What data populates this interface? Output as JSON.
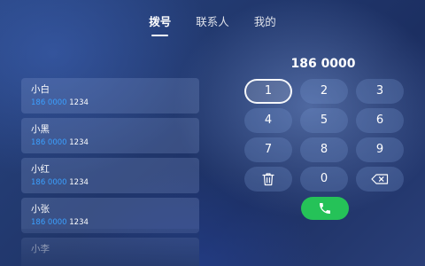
{
  "tabs": [
    {
      "label": "拨号",
      "active": true
    },
    {
      "label": "联系人",
      "active": false
    },
    {
      "label": "我的",
      "active": false
    }
  ],
  "contacts": [
    {
      "name": "小白",
      "number_match": "186 0000",
      "number_rest": " 1234"
    },
    {
      "name": "小黑",
      "number_match": "186 0000",
      "number_rest": " 1234"
    },
    {
      "name": "小红",
      "number_match": "186 0000",
      "number_rest": " 1234"
    },
    {
      "name": "小张",
      "number_match": "186 0000",
      "number_rest": " 1234"
    },
    {
      "name": "小李"
    }
  ],
  "dial": {
    "display": "186 0000"
  },
  "keypad": [
    "1",
    "2",
    "3",
    "4",
    "5",
    "6",
    "7",
    "8",
    "9",
    "0"
  ],
  "icons": {
    "delete": "trash-icon",
    "backspace": "backspace-icon",
    "call": "phone-icon"
  },
  "colors": {
    "highlight": "#3aa0ff",
    "call": "#25c258"
  }
}
